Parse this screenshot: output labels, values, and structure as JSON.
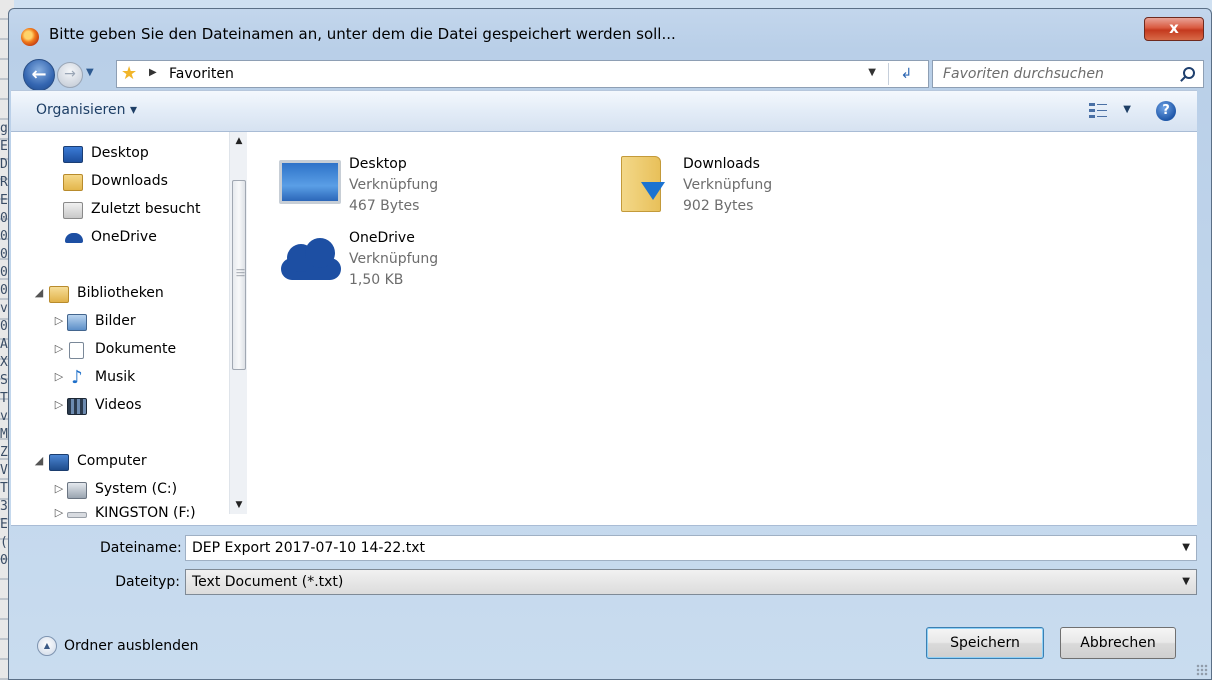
{
  "dialog": {
    "title": "Bitte geben Sie den Dateinamen an, unter dem die Datei gespeichert werden soll...",
    "close_label": "x"
  },
  "address": {
    "back_label": "←",
    "forward_label": "→",
    "location": "Favoriten",
    "refresh_label": "↲"
  },
  "search": {
    "placeholder": "Favoriten durchsuchen"
  },
  "toolbar": {
    "organize_label": "Organisieren ▾",
    "help_label": "?"
  },
  "left_edge_text": "g\nE\nD\nR\nE\n0\n0\n0\n0\n0\nv\n0\nA\nX\nS\nT\nv\nM\nZ\nV\nT\n3\nE\n(\n0",
  "nav": {
    "favorites": [
      {
        "label": "Desktop",
        "icon": "desktop-icon"
      },
      {
        "label": "Downloads",
        "icon": "downloads-icon"
      },
      {
        "label": "Zuletzt besucht",
        "icon": "recent-places-icon"
      },
      {
        "label": "OneDrive",
        "icon": "onedrive-icon"
      }
    ],
    "libraries_label": "Bibliotheken",
    "libraries": [
      {
        "label": "Bilder",
        "icon": "pictures-icon"
      },
      {
        "label": "Dokumente",
        "icon": "documents-icon"
      },
      {
        "label": "Musik",
        "icon": "music-icon"
      },
      {
        "label": "Videos",
        "icon": "videos-icon"
      }
    ],
    "computer_label": "Computer",
    "drives": [
      {
        "label": "System (C:)",
        "icon": "system-drive-icon"
      },
      {
        "label": "KINGSTON (F:)",
        "icon": "usb-drive-icon"
      }
    ]
  },
  "files": [
    {
      "name": "Desktop",
      "type": "Verknüpfung",
      "size": "467 Bytes",
      "icon": "desktop-shortcut-icon"
    },
    {
      "name": "Downloads",
      "type": "Verknüpfung",
      "size": "902 Bytes",
      "icon": "downloads-folder-icon"
    },
    {
      "name": "OneDrive",
      "type": "Verknüpfung",
      "size": "1,50 KB",
      "icon": "onedrive-cloud-icon"
    }
  ],
  "form": {
    "filename_label": "Dateiname:",
    "filename_value": "DEP Export 2017-07-10 14-22.txt",
    "filetype_label": "Dateityp:",
    "filetype_value": "Text Document (*.txt)"
  },
  "footer": {
    "hide_folders_label": "Ordner ausblenden",
    "save_label": "Speichern",
    "cancel_label": "Abbrechen"
  },
  "colors": {
    "window_frame": "#b9cfe8",
    "accent_blue": "#1f57a8",
    "close_red": "#c4391e"
  }
}
